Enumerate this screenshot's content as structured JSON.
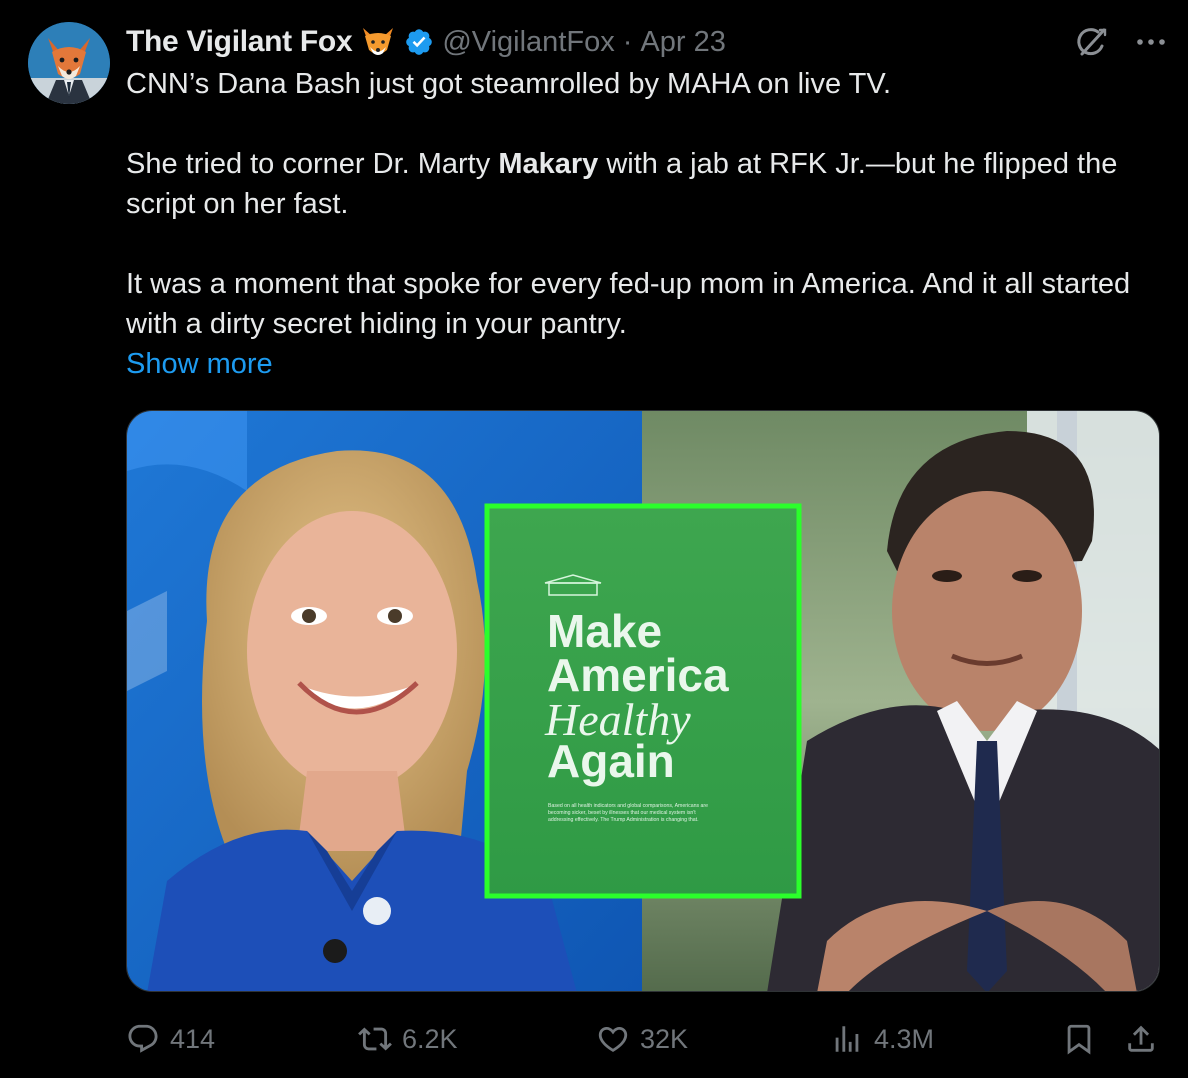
{
  "tweet": {
    "author_name": "The Vigilant Fox",
    "emoji_icon": "fox-face-icon",
    "verified_icon": "verified-badge-icon",
    "handle": "@VigilantFox",
    "separator": "·",
    "date": "Apr 23",
    "text": {
      "p1": "CNN’s Dana Bash just got steamrolled by MAHA on live TV.",
      "p2_before": "She tried to corner Dr. Marty ",
      "p2_bold": "Makary",
      "p2_after": " with a jab at RFK Jr.—but he flipped the script on her fast.",
      "p3": "It was a moment that spoke for every fed-up mom in America. And it all started with a dirty secret hiding in your pantry."
    },
    "show_more": "Show more"
  },
  "media": {
    "poster": {
      "line1": "Make",
      "line2": "America",
      "line3": "Healthy",
      "line4": "Again",
      "fineprint1": "Based on all health indicators and global comparisons, Americans are",
      "fineprint2": "becoming sicker, beset by illnesses that our medical system isn't",
      "fineprint3": "addressing effectively. The Trump Administration is changing that."
    },
    "accent_color": "#2bff2b"
  },
  "actions": {
    "replies": "414",
    "reposts": "6.2K",
    "likes": "32K",
    "views": "4.3M"
  },
  "colors": {
    "background": "#000000",
    "text": "#e7e9ea",
    "muted": "#71767b",
    "link": "#1d9bf0",
    "verified": "#1d9bf0"
  }
}
